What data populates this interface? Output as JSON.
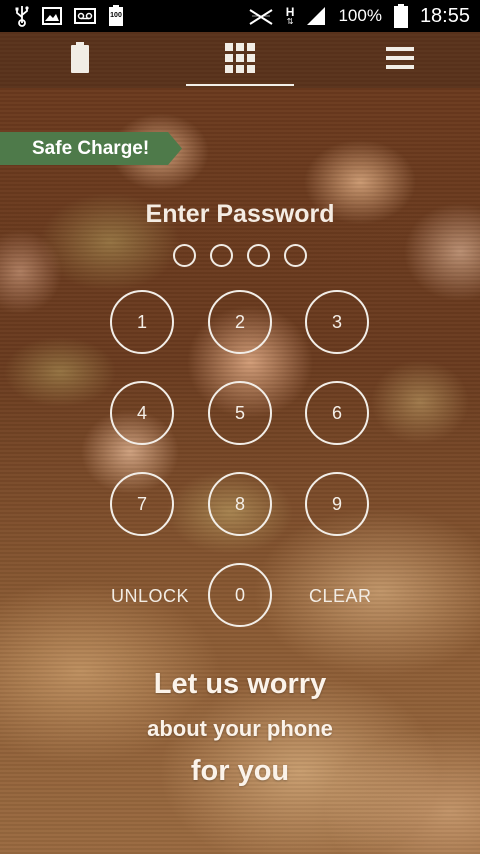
{
  "status_bar": {
    "left_icons": [
      "usb-icon",
      "image-icon",
      "voicemail-icon",
      "battery-100-icon"
    ],
    "battery_small_label": "100",
    "network_label": "H",
    "battery_percent": "100%",
    "time": "18:55"
  },
  "nav": {
    "tabs": [
      {
        "name": "battery-tab",
        "icon": "battery-icon",
        "active": false
      },
      {
        "name": "grid-tab",
        "icon": "grid-icon",
        "active": true
      },
      {
        "name": "menu-tab",
        "icon": "menu-icon",
        "active": false
      }
    ]
  },
  "banner": {
    "label": "Safe Charge!",
    "color": "#4e7a4a"
  },
  "lock": {
    "title": "Enter Password",
    "entered_digits": 0,
    "total_digits": 4,
    "keys": [
      "1",
      "2",
      "3",
      "4",
      "5",
      "6",
      "7",
      "8",
      "9",
      "0"
    ],
    "unlock_label": "UNLOCK",
    "clear_label": "CLEAR"
  },
  "slogan": {
    "line1": "Let us worry",
    "line2": "about your phone",
    "line3": "for you"
  }
}
